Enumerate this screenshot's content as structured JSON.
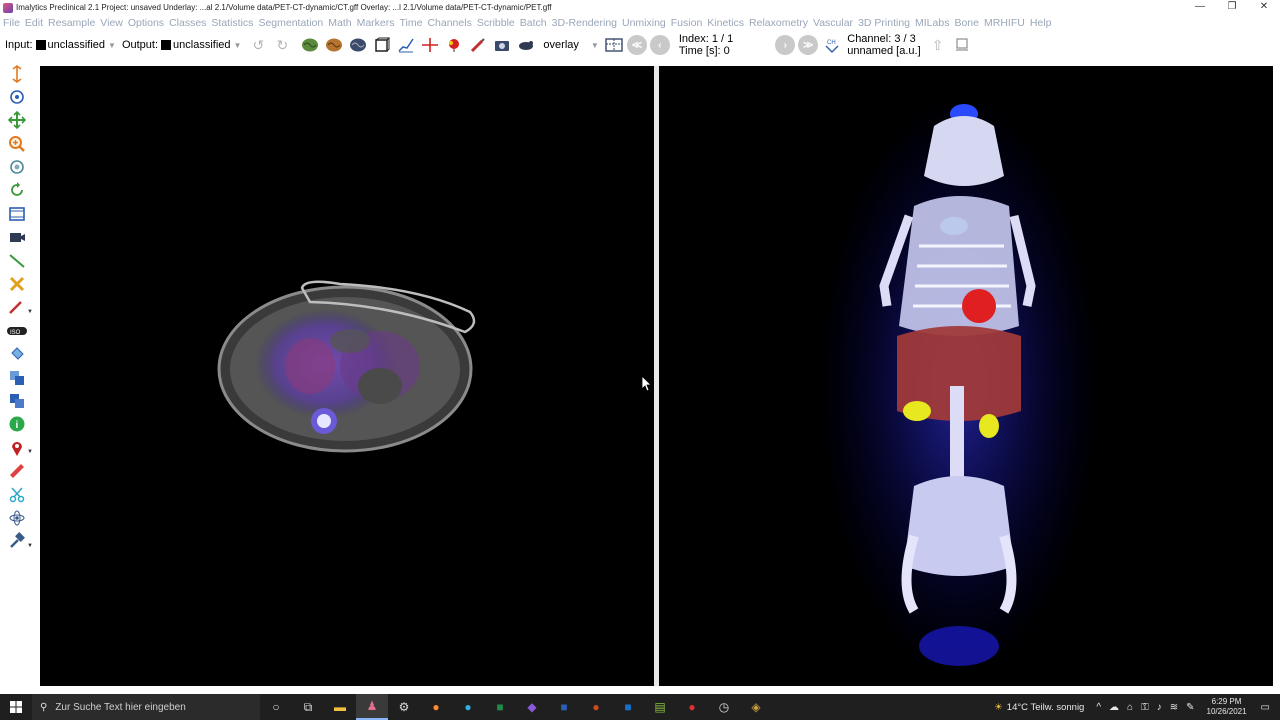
{
  "window": {
    "title": "Imalytics Preclinical 2.1 Project: unsaved   Underlay: ...al 2.1/Volume data/PET-CT-dynamic/CT.gff   Overlay: ...l 2.1/Volume data/PET-CT-dynamic/PET.gff",
    "controls": [
      "—",
      "❐",
      "✕"
    ]
  },
  "menu": [
    "File",
    "Edit",
    "Resample",
    "View",
    "Options",
    "Classes",
    "Statistics",
    "Segmentation",
    "Math",
    "Markers",
    "Time",
    "Channels",
    "Scribble",
    "Batch",
    "3D-Rendering",
    "Unmixing",
    "Fusion",
    "Kinetics",
    "Relaxometry",
    "Vascular",
    "3D Printing",
    "MILabs",
    "Bone",
    "MRHIFU",
    "Help"
  ],
  "toolbar": {
    "input_label": "Input:",
    "input_value": "unclassified",
    "output_label": "Output:",
    "output_value": "unclassified",
    "overlay_value": "overlay",
    "index_text": "Index: 1 / 1",
    "time_text": "Time [s]: 0",
    "channel_text": "Channel: 3 / 3",
    "unit_text": "unnamed [a.u.]",
    "ch_label": "CH"
  },
  "taskbar": {
    "search_placeholder": "Zur Suche Text hier eingeben",
    "weather": "14°C  Teilw. sonnig",
    "time": "6:29 PM",
    "date": "10/26/2021"
  }
}
